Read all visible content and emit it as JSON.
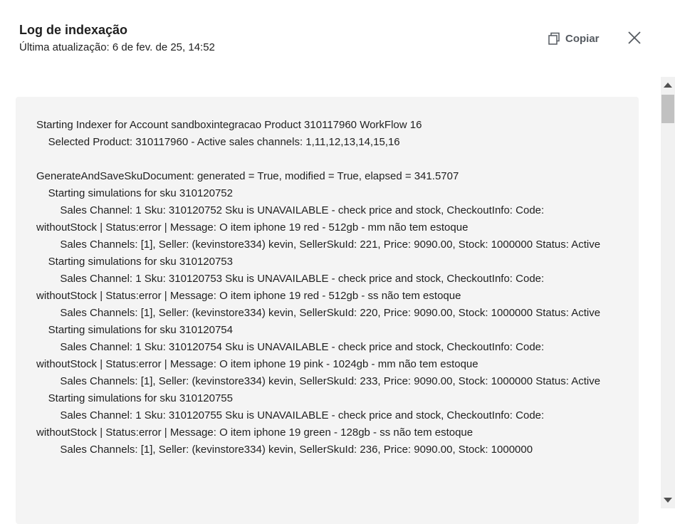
{
  "header": {
    "title": "Log de indexação",
    "subtitle": "Última atualização: 6 de fev. de 25, 14:52"
  },
  "toolbar": {
    "copy_label": "Copiar",
    "copy_icon": "copy-icon",
    "close_icon": "close-icon"
  },
  "log": {
    "text": "Starting Indexer for Account sandboxintegracao Product 310117960 WorkFlow 16\n    Selected Product: 310117960 - Active sales channels: 1,11,12,13,14,15,16\n\nGenerateAndSaveSkuDocument: generated = True, modified = True, elapsed = 341.5707\n    Starting simulations for sku 310120752\n        Sales Channel: 1 Sku: 310120752 Sku is UNAVAILABLE - check price and stock, CheckoutInfo: Code: withoutStock | Status:error | Message: O item iphone 19 red - 512gb - mm não tem estoque\n        Sales Channels: [1], Seller: (kevinstore334) kevin, SellerSkuId: 221, Price: 9090.00, Stock: 1000000 Status: Active\n    Starting simulations for sku 310120753\n        Sales Channel: 1 Sku: 310120753 Sku is UNAVAILABLE - check price and stock, CheckoutInfo: Code: withoutStock | Status:error | Message: O item iphone 19 red - 512gb - ss não tem estoque\n        Sales Channels: [1], Seller: (kevinstore334) kevin, SellerSkuId: 220, Price: 9090.00, Stock: 1000000 Status: Active\n    Starting simulations for sku 310120754\n        Sales Channel: 1 Sku: 310120754 Sku is UNAVAILABLE - check price and stock, CheckoutInfo: Code: withoutStock | Status:error | Message: O item iphone 19 pink - 1024gb - mm não tem estoque\n        Sales Channels: [1], Seller: (kevinstore334) kevin, SellerSkuId: 233, Price: 9090.00, Stock: 1000000 Status: Active\n    Starting simulations for sku 310120755\n        Sales Channel: 1 Sku: 310120755 Sku is UNAVAILABLE - check price and stock, CheckoutInfo: Code: withoutStock | Status:error | Message: O item iphone 19 green - 128gb - ss não tem estoque\n        Sales Channels: [1], Seller: (kevinstore334) kevin, SellerSkuId: 236, Price: 9090.00, Stock: 1000000"
  }
}
